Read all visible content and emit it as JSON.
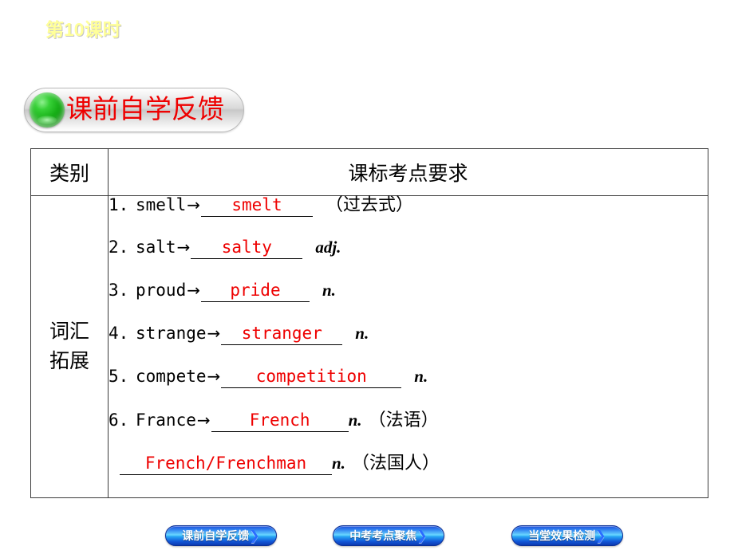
{
  "slide": {
    "title": "第10课时",
    "title_color": "#ffff99"
  },
  "section_header": {
    "label": "课前自学反馈",
    "label_color": "#ee0000",
    "bulb_icon": "green-sphere-icon",
    "bulb_color": "#10a810"
  },
  "table": {
    "headers": {
      "category": "类别",
      "requirement": "课标考点要求"
    },
    "category_label_lines": [
      "词汇",
      "拓展"
    ],
    "answer_color": "#ee0000",
    "rows": [
      {
        "num": "1.",
        "base": "smell",
        "arrow": "→",
        "answer": "smelt",
        "pos": "",
        "note": "（过去式）"
      },
      {
        "num": "2.",
        "base": "salt",
        "arrow": "→",
        "answer": "salty",
        "pos": "adj.",
        "note": ""
      },
      {
        "num": "3.",
        "base": "proud",
        "arrow": "→",
        "answer": "pride",
        "pos": "n.",
        "note": ""
      },
      {
        "num": "4.",
        "base": "strange",
        "arrow": "→",
        "answer": "stranger",
        "pos": "n.",
        "note": ""
      },
      {
        "num": "5.",
        "base": "compete",
        "arrow": "→",
        "answer": "competition",
        "pos": "n.",
        "note": ""
      },
      {
        "num": "6.",
        "base": "France",
        "arrow": "→",
        "answer": "French",
        "pos": "n.",
        "note": "（法语）"
      }
    ],
    "extra_row": {
      "answer": "French/Frenchman",
      "pos": "n.",
      "note": "（法国人）"
    }
  },
  "bottom_nav": {
    "chevron_icon": "chevron-right-icon",
    "chevron_glyph": "❯",
    "buttons": [
      {
        "label": "课前自学反馈"
      },
      {
        "label": "中考考点聚焦"
      },
      {
        "label": "当堂效果检测"
      }
    ]
  }
}
